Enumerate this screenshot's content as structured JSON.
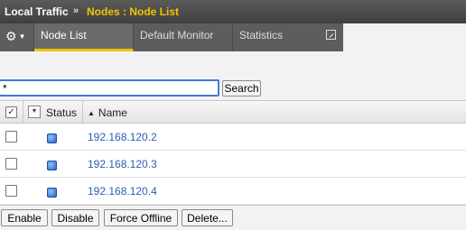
{
  "breadcrumb": {
    "section": "Local Traffic",
    "separator": "»",
    "page": "Nodes : Node List"
  },
  "tabs": {
    "active": "Node List",
    "items": [
      "Default Monitor",
      "Statistics"
    ]
  },
  "search": {
    "value": "*",
    "button": "Search"
  },
  "table": {
    "columns": {
      "status": "Status",
      "name": "Name"
    },
    "rows": [
      {
        "name": "192.168.120.2",
        "status_color": "#2a62c8"
      },
      {
        "name": "192.168.120.3",
        "status_color": "#2a62c8"
      },
      {
        "name": "192.168.120.4",
        "status_color": "#2a62c8"
      }
    ]
  },
  "actions": {
    "enable": "Enable",
    "disable": "Disable",
    "force_offline": "Force Offline",
    "delete": "Delete..."
  },
  "colors": {
    "accent": "#f0c400",
    "link": "#2b5fb4",
    "focus": "#3d7bd9"
  }
}
